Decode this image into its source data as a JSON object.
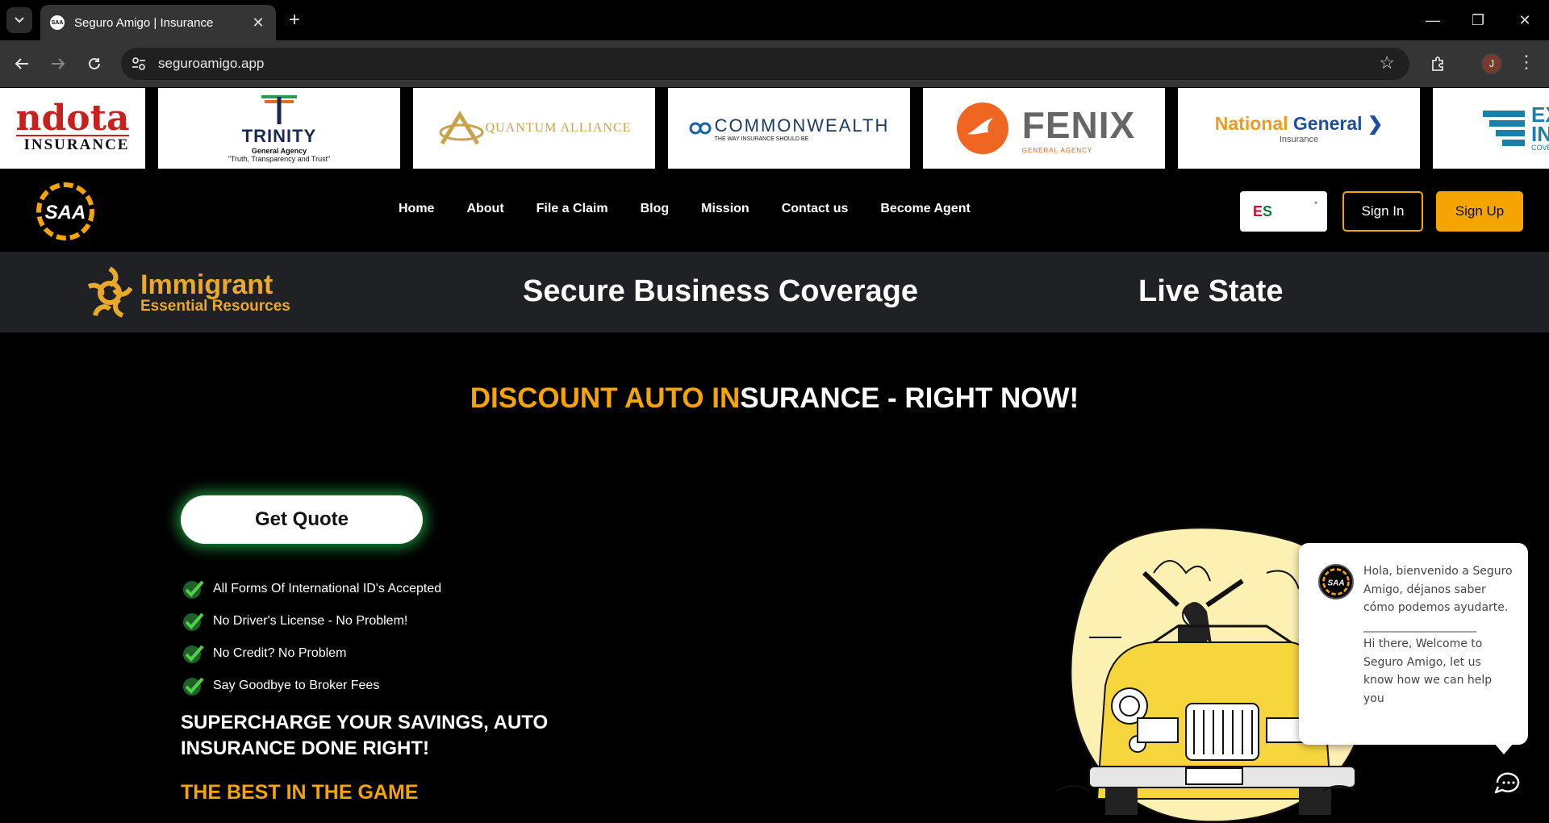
{
  "browser": {
    "tab_title": "Seguro Amigo | Insurance",
    "url": "seguroamigo.app",
    "profile_initial": "J"
  },
  "logos": {
    "dota": {
      "name": "ndota",
      "sub": "INSURANCE"
    },
    "trinity": {
      "name": "TRINITY",
      "sub": "General Agency",
      "tagline": "\"Truth, Transparency and Trust\""
    },
    "quantum": {
      "name": "QUANTUM ALLIANCE"
    },
    "commonwealth": {
      "name": "COMMONWEALTH",
      "sub": "THE WAY INSURANCE SHOULD BE"
    },
    "fenix": {
      "name": "FENIX",
      "sub": "GENERAL AGENCY"
    },
    "national_general": {
      "name_a": "National",
      "name_b": "General",
      "sub": "Insurance"
    },
    "excel": {
      "name_a": "EXC",
      "name_b": "INS",
      "sub": "COVER"
    }
  },
  "header": {
    "nav": [
      "Home",
      "About",
      "File a Claim",
      "Blog",
      "Mission",
      "Contact us",
      "Become Agent"
    ],
    "lang_e": "E",
    "lang_s": "S",
    "signin": "Sign In",
    "signup": "Sign Up"
  },
  "band": {
    "logo_line1": "Immigrant",
    "logo_line2": "Essential Resources",
    "item1": "Secure Business Coverage",
    "item2": "Live State"
  },
  "hero": {
    "title_orange": "DISCOUNT AUTO IN",
    "title_white": "SURANCE - RIGHT NOW!",
    "quote_button": "Get Quote",
    "features": [
      "All Forms Of International ID's Accepted",
      "No Driver's License - No Problem!",
      "No Credit? No Problem",
      "Say Goodbye to Broker Fees"
    ],
    "supercharge": "SUPERCHARGE YOUR SAVINGS, AUTO INSURANCE DONE RIGHT!",
    "best": "THE BEST IN THE GAME"
  },
  "chat": {
    "line_es": "Hola, bienvenido a Seguro Amigo, déjanos saber cómo podemos ayudarte.",
    "divider": "____________________",
    "line_en": "Hi there, Welcome to Seguro Amigo, let us know how we can help you"
  },
  "colors": {
    "accent": "#f5a400",
    "band": "#202124",
    "glow": "#28c850"
  }
}
